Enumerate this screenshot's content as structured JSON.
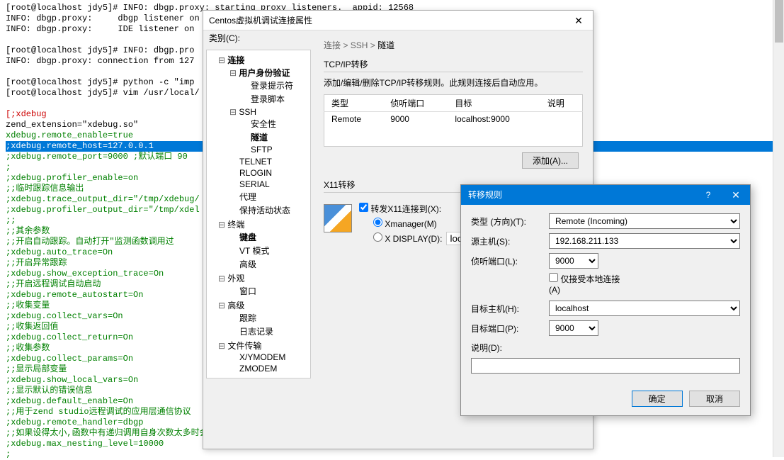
{
  "terminal": {
    "lines": [
      {
        "cls": "",
        "txt": "[root@localhost jdy5]# INFO: dbgp.proxy: starting proxy listeners.  appid: 12568"
      },
      {
        "cls": "",
        "txt": "INFO: dbgp.proxy:     dbgp listener on"
      },
      {
        "cls": "",
        "txt": "INFO: dbgp.proxy:     IDE listener on"
      },
      {
        "cls": "",
        "txt": ""
      },
      {
        "cls": "",
        "txt": "[root@localhost jdy5]# INFO: dbgp.pro                                                    1]"
      },
      {
        "cls": "",
        "txt": "INFO: dbgp.proxy: connection from 127"
      },
      {
        "cls": "",
        "txt": ""
      },
      {
        "cls": "",
        "txt": "[root@localhost jdy5]# python -c \"imp"
      },
      {
        "cls": "",
        "txt": "[root@localhost jdy5]# vim /usr/local/"
      },
      {
        "cls": "",
        "txt": ""
      },
      {
        "cls": "t-red",
        "txt": "[;xdebug"
      },
      {
        "cls": "",
        "txt": "zend_extension=\"xdebug.so\""
      },
      {
        "cls": "t-green",
        "txt": "xdebug.remote_enable=true"
      },
      {
        "cls": "sel",
        "txt": ";xdebug.remote_host=127.0.0.1"
      },
      {
        "cls": "t-green",
        "txt": ";xdebug.remote_port=9000 ;默认端口 90"
      },
      {
        "cls": "t-green",
        "txt": ";"
      },
      {
        "cls": "t-green",
        "txt": ";xdebug.profiler_enable=on"
      },
      {
        "cls": "t-green",
        "txt": ";;临时跟踪信息输出"
      },
      {
        "cls": "t-green",
        "txt": ";xdebug.trace_output_dir=\"/tmp/xdebug/"
      },
      {
        "cls": "t-green",
        "txt": ";xdebug.profiler_output_dir=\"/tmp/xdel"
      },
      {
        "cls": "t-green",
        "txt": ";;"
      },
      {
        "cls": "t-green",
        "txt": ";;其余参数"
      },
      {
        "cls": "t-green",
        "txt": ";;开启自动跟踪。自动打开\"监测函数调用过"
      },
      {
        "cls": "t-green",
        "txt": ";xdebug.auto_trace=On"
      },
      {
        "cls": "t-green",
        "txt": ";;开启异常跟踪"
      },
      {
        "cls": "t-green",
        "txt": ";xdebug.show_exception_trace=On"
      },
      {
        "cls": "t-green",
        "txt": ";;开启远程调试自动启动"
      },
      {
        "cls": "t-green",
        "txt": ";xdebug.remote_autostart=On"
      },
      {
        "cls": "t-green",
        "txt": ";;收集变量"
      },
      {
        "cls": "t-green",
        "txt": ";xdebug.collect_vars=On"
      },
      {
        "cls": "t-green",
        "txt": ";;收集返回值"
      },
      {
        "cls": "t-green",
        "txt": ";xdebug.collect_return=On"
      },
      {
        "cls": "t-green",
        "txt": ";;收集参数"
      },
      {
        "cls": "t-green",
        "txt": ";xdebug.collect_params=On"
      },
      {
        "cls": "t-green",
        "txt": ";;显示局部变量"
      },
      {
        "cls": "t-green",
        "txt": ";xdebug.show_local_vars=On"
      },
      {
        "cls": "t-green",
        "txt": ";;显示默认的错误信息"
      },
      {
        "cls": "t-green",
        "txt": ";xdebug.default_enable=On"
      },
      {
        "cls": "t-green",
        "txt": ";;用于zend studio远程调试的应用层通信协议"
      },
      {
        "cls": "t-green",
        "txt": ";xdebug.remote_handler=dbgp"
      },
      {
        "cls": "t-green",
        "txt": ";;如果设得太小,函数中有递归调用自身次数太多时会报超过最大嵌套数错"
      },
      {
        "cls": "t-green",
        "txt": ";xdebug.max_nesting_level=10000"
      },
      {
        "cls": "t-green",
        "txt": ";"
      }
    ]
  },
  "dlg1": {
    "title": "Centos虚拟机调试连接属性",
    "tree_label": "类别(C):",
    "tree": {
      "n_conn": "连接",
      "n_auth": "用户身份验证",
      "l_prompt": "登录提示符",
      "l_script": "登录脚本",
      "n_ssh": "SSH",
      "l_sec": "安全性",
      "l_tunnel": "隧道",
      "l_sftp": "SFTP",
      "l_telnet": "TELNET",
      "l_rlogin": "RLOGIN",
      "l_serial": "SERIAL",
      "l_proxy": "代理",
      "l_keep": "保持活动状态",
      "n_term": "终端",
      "l_kbd": "键盘",
      "l_vt": "VT 模式",
      "l_adv": "高级",
      "n_look": "外观",
      "l_win": "窗口",
      "n_hadv": "高级",
      "l_trace": "跟踪",
      "l_log": "日志记录",
      "n_file": "文件传输",
      "l_xy": "X/YMODEM",
      "l_z": "ZMODEM"
    },
    "breadcrumb": {
      "p1": "连接",
      "p2": "SSH",
      "p3": "隧道"
    },
    "group1": {
      "title": "TCP/IP转移",
      "desc": "添加/编辑/删除TCP/IP转移规则。此规则连接后自动应用。",
      "th": {
        "type": "类型",
        "port": "侦听端口",
        "target": "目标",
        "note": "说明"
      },
      "row": {
        "type": "Remote",
        "port": "9000",
        "target": "localhost:9000",
        "note": ""
      },
      "btn_add": "添加(A)..."
    },
    "group2": {
      "title": "X11转移",
      "cb": "转发X11连接到(X):",
      "r1": "Xmanager(M)",
      "r2": "X DISPLAY(D):",
      "r2v": "localho"
    }
  },
  "dlg2": {
    "title": "转移规则",
    "fields": {
      "type_l": "类型 (方向)(T):",
      "type_v": "Remote (Incoming)",
      "src_l": "源主机(S):",
      "src_v": "192.168.211.133",
      "lport_l": "侦听端口(L):",
      "lport_v": "9000",
      "local_only": "仅接受本地连接(A)",
      "dhost_l": "目标主机(H):",
      "dhost_v": "localhost",
      "dport_l": "目标端口(P):",
      "dport_v": "9000",
      "desc_l": "说明(D):",
      "desc_v": ""
    },
    "ok": "确定",
    "cancel": "取消"
  }
}
